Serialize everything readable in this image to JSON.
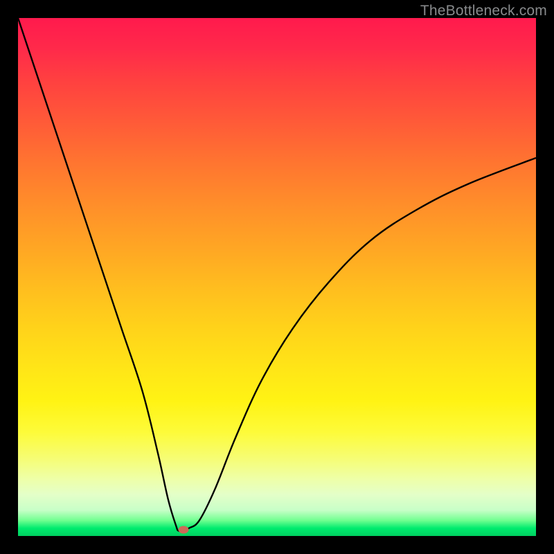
{
  "watermark": "TheBottleneck.com",
  "colors": {
    "curve_stroke": "#000000",
    "dot_fill": "#cd6a58",
    "frame_border": "#000000"
  },
  "chart_data": {
    "type": "line",
    "title": "",
    "xlabel": "",
    "ylabel": "",
    "xlim": [
      0,
      100
    ],
    "ylim": [
      0,
      100
    ],
    "grid": false,
    "legend": false,
    "series": [
      {
        "name": "bottleneck-curve",
        "x": [
          0,
          4,
          8,
          12,
          16,
          20,
          24,
          27,
          29,
          30.5,
          31,
          32,
          33,
          35,
          38,
          42,
          47,
          53,
          60,
          68,
          77,
          87,
          100
        ],
        "y": [
          100,
          88,
          76,
          64,
          52,
          40,
          28,
          16,
          7,
          2,
          1,
          1,
          1.5,
          3,
          9,
          19,
          30,
          40,
          49,
          57,
          63,
          68,
          73
        ]
      }
    ],
    "marker": {
      "x": 32,
      "y": 1.2
    },
    "notes": "Values are read visually from an unlabeled gradient chart; x and y are in 0–100 percent of the plot area (y measured from bottom)."
  }
}
